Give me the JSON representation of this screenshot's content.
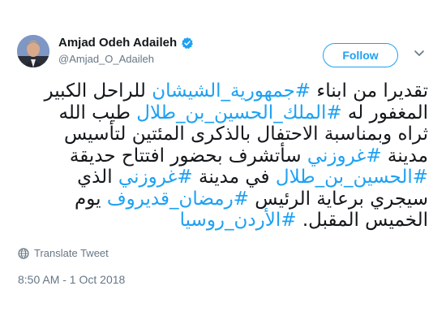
{
  "author": {
    "name": "Amjad Odeh Adaileh",
    "handle": "@Amjad_O_Adaileh",
    "verified": true
  },
  "follow_label": "Follow",
  "tweet": {
    "lines": [
      [
        {
          "t": "تقديرا من ابناء ",
          "h": false
        },
        {
          "t": "#جمهورية_الشيشان",
          "h": true
        },
        {
          "t": " للراحل الكبير",
          "h": false
        }
      ],
      [
        {
          "t": "المغفور له ",
          "h": false
        },
        {
          "t": "#الملك_الحسين_بن_طلال",
          "h": true
        },
        {
          "t": " طيب الله",
          "h": false
        }
      ],
      [
        {
          "t": "ثراه وبمناسبة الاحتفال بالذكرى المئتين لتأسيس",
          "h": false
        }
      ],
      [
        {
          "t": "مدينة ",
          "h": false
        },
        {
          "t": "#غروزني",
          "h": true
        },
        {
          "t": " سأتشرف بحضور افتتاح حديقة",
          "h": false
        }
      ],
      [
        {
          "t": "#الحسين_بن_طلال",
          "h": true
        },
        {
          "t": " في مدينة ",
          "h": false
        },
        {
          "t": "#غروزني",
          "h": true
        },
        {
          "t": " الذي",
          "h": false
        }
      ],
      [
        {
          "t": "سيجري برعاية الرئيس ",
          "h": false
        },
        {
          "t": "#رمضان_قديروف",
          "h": true
        },
        {
          "t": " يوم",
          "h": false
        }
      ],
      [
        {
          "t": "الخميس المقبل. ",
          "h": false
        },
        {
          "t": "#الأردن_روسيا",
          "h": true
        }
      ]
    ]
  },
  "translate_label": "Translate Tweet",
  "timestamp": "8:50 AM - 1 Oct 2018",
  "colors": {
    "accent": "#1da1f2",
    "muted": "#657786",
    "text": "#14171a"
  },
  "icons": {
    "verified": "verified-badge-icon",
    "chevron": "chevron-down-icon",
    "globe": "globe-icon"
  }
}
